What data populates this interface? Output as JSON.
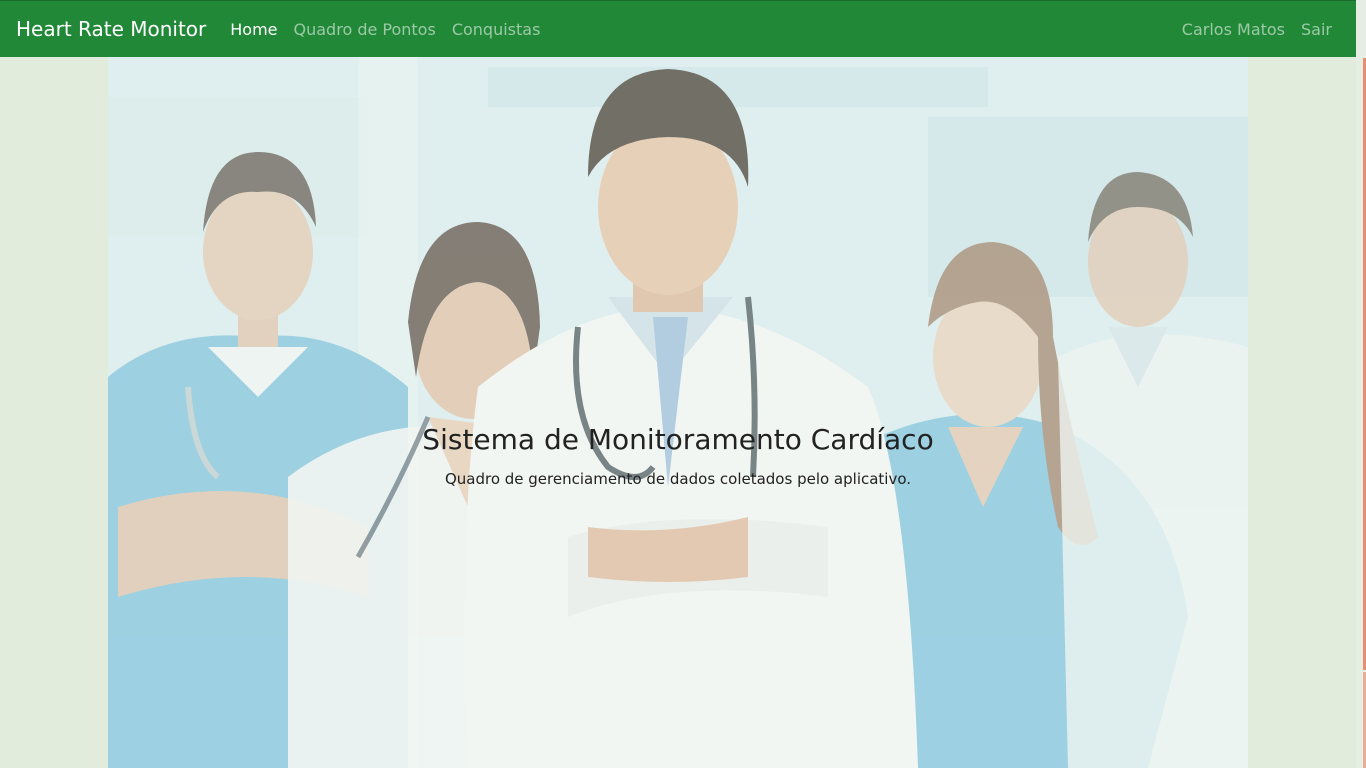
{
  "navbar": {
    "brand": "Heart Rate Monitor",
    "links": [
      {
        "label": "Home",
        "active": true
      },
      {
        "label": "Quadro de Pontos",
        "active": false
      },
      {
        "label": "Conquistas",
        "active": false
      }
    ],
    "user_name": "Carlos Matos",
    "logout_label": "Sair"
  },
  "hero": {
    "title": "Sistema de Monitoramento Cardíaco",
    "subtitle": "Quadro de gerenciamento de dados coletados pelo aplicativo.",
    "image_description_icon": "medical-team-photo"
  },
  "colors": {
    "navbar_bg": "#218838",
    "page_bg": "#e2ecdd",
    "scrub_blue": "#5fb2d8",
    "coat_white": "#f2f4f4"
  }
}
